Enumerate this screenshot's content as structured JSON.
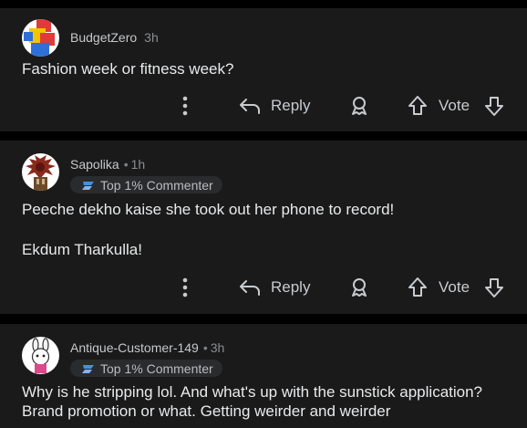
{
  "comments": [
    {
      "username": "BudgetZero",
      "separator": "",
      "time": "3h",
      "badge": "",
      "lines": [
        "Fashion week or fitness week?"
      ],
      "reply_label": "Reply",
      "vote_label": "Vote"
    },
    {
      "username": "Sapolika",
      "separator": "•",
      "time": "1h",
      "badge": "Top 1% Commenter",
      "lines": [
        "Peeche dekho kaise she took out her phone to record!",
        "Ekdum Tharkulla!"
      ],
      "reply_label": "Reply",
      "vote_label": "Vote"
    },
    {
      "username": "Antique-Customer-149",
      "separator": "•",
      "time": "3h",
      "badge": "Top 1% Commenter",
      "lines": [
        "Why is he stripping lol. And what's up with the sunstick application?",
        "Brand promotion or what. Getting weirder and weirder"
      ]
    }
  ],
  "colors": {
    "background": "#000000",
    "card": "#1a1a1b",
    "text": "#e8eaeb",
    "badge_bg": "#2a2b2d",
    "badge_icon": "#4a90d9"
  }
}
